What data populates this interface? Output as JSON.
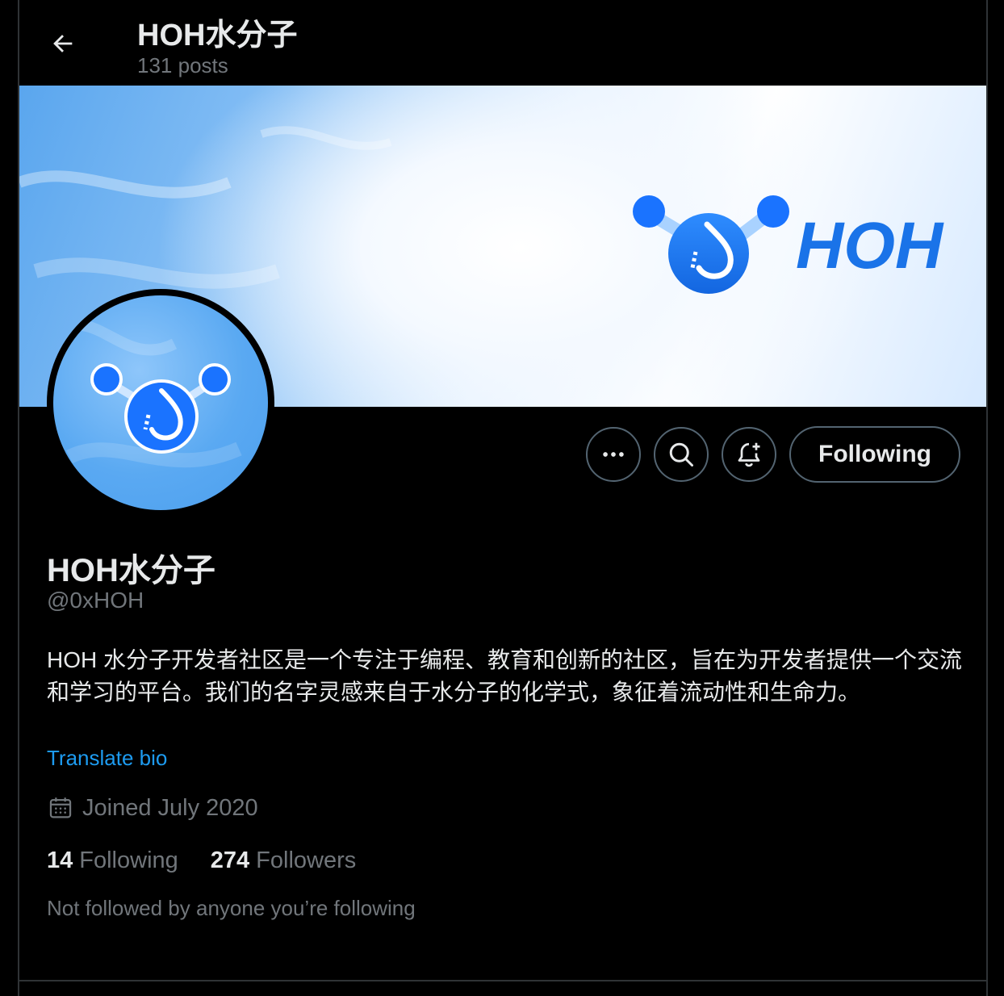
{
  "header": {
    "title": "HOH水分子",
    "posts": "131 posts"
  },
  "banner": {
    "logo_text": "HOH"
  },
  "actions": {
    "more": "more",
    "search": "search",
    "notify": "notify",
    "follow_label": "Following"
  },
  "profile": {
    "name": "HOH水分子",
    "handle": "@0xHOH",
    "bio": "HOH 水分子开发者社区是一个专注于编程、教育和创新的社区，旨在为开发者提供一个交流和学习的平台。我们的名字灵感来自于水分子的化学式，象征着流动性和生命力。",
    "translate": "Translate bio",
    "joined": "Joined July 2020",
    "following_count": "14",
    "following_label": "Following",
    "followers_count": "274",
    "followers_label": "Followers",
    "not_followed": "Not followed by anyone you’re following"
  },
  "colors": {
    "accent": "#1d9bf0",
    "brand_blue": "#1a73e8",
    "muted": "#71767b"
  }
}
